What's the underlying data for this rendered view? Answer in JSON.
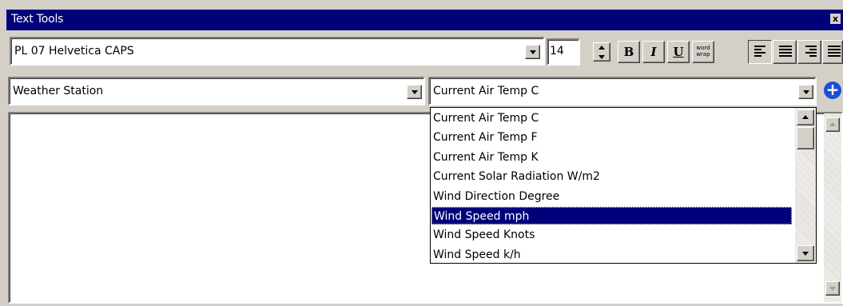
{
  "window": {
    "title": "Text Tools",
    "close_glyph": "x"
  },
  "toolbar": {
    "font_name": "PL 07 Helvetica CAPS",
    "font_size": "14",
    "bold_label": "B",
    "italic_label": "I",
    "underline_label": "U",
    "word_wrap_label_line1": "word",
    "word_wrap_label_line2": "wrap",
    "align_buttons": [
      "align-left",
      "align-center",
      "align-right"
    ]
  },
  "source_select": {
    "value": "Weather Station"
  },
  "field_select": {
    "value": "Current Air Temp C",
    "options": [
      "Current Air Temp C",
      "Current Air Temp F",
      "Current Air Temp K",
      "Current Solar Radiation W/m2",
      "Wind Direction Degree",
      "Wind Speed mph",
      "Wind Speed Knots",
      "Wind Speed k/h"
    ],
    "selected_index": 5
  },
  "colors": {
    "title_bar": "#00007b",
    "face": "#d4d0c8",
    "selection": "#00007b",
    "add_icon": "#1a4fd8"
  }
}
